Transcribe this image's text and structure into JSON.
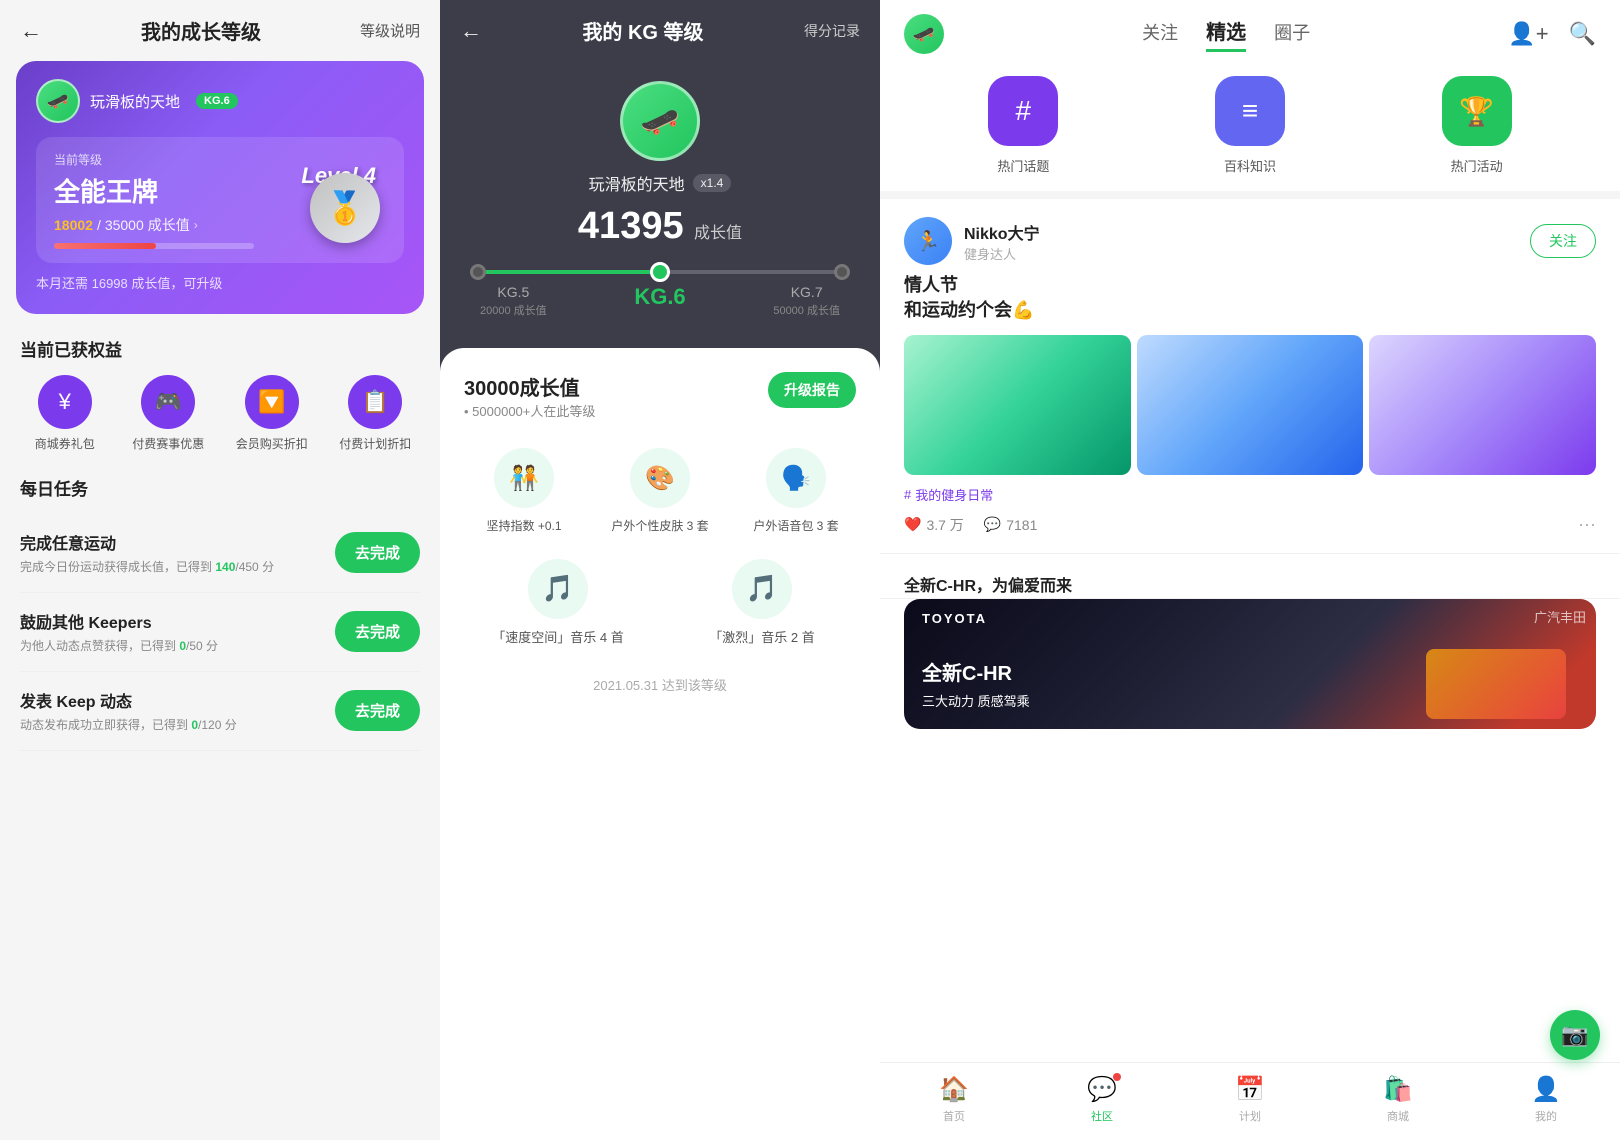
{
  "panel1": {
    "header": {
      "back_label": "←",
      "title": "我的成长等级",
      "desc_label": "等级说明"
    },
    "hero": {
      "username": "玩滑板的天地",
      "kg_badge": "KG.6",
      "current_level_label": "当前等级",
      "level_name": "全能王牌",
      "level_display": "Level 4",
      "progress_current": "18002",
      "progress_total": "35000",
      "progress_unit": "成长值",
      "upgrade_hint": "本月还需 16998 成长值，可升级",
      "medal_emoji": "🥇"
    },
    "benefits_title": "当前已获权益",
    "benefits": [
      {
        "icon": "¥",
        "label": "商城券礼包",
        "color": "#7c3aed"
      },
      {
        "icon": "🎮",
        "label": "付费赛事优惠",
        "color": "#7c3aed"
      },
      {
        "icon": "🔽",
        "label": "会员购买折扣",
        "color": "#7c3aed"
      },
      {
        "icon": "📋",
        "label": "付费计划折扣",
        "color": "#7c3aed"
      }
    ],
    "daily_tasks_title": "每日任务",
    "tasks": [
      {
        "name": "完成任意运动",
        "desc": "完成今日份运动获得成长值，已得到 140/450 分",
        "highlight_start": "140",
        "highlight_end": "450",
        "btn_label": "去完成"
      },
      {
        "name": "鼓励其他 Keepers",
        "desc": "为他人动态点赞获得，已得到 0/50 分",
        "highlight_start": "0",
        "highlight_end": "50",
        "btn_label": "去完成"
      },
      {
        "name": "发表 Keep 动态",
        "desc": "动态发布成功立即获得，已得到 0/120 分",
        "highlight_start": "0",
        "highlight_end": "120",
        "btn_label": "去完成"
      }
    ]
  },
  "panel2": {
    "header": {
      "back_label": "←",
      "title": "我的 KG 等级",
      "score_record": "得分记录"
    },
    "hero": {
      "username": "玩滑板的天地",
      "multiplier": "x1.4",
      "growth_value": "41395",
      "growth_unit": "成长值"
    },
    "slider": {
      "levels": [
        {
          "name": "KG.5",
          "sub": "20000 成长值",
          "active": false
        },
        {
          "name": "KG.6",
          "sub": "",
          "active": true
        },
        {
          "name": "KG.7",
          "sub": "50000 成长值",
          "active": false
        }
      ]
    },
    "card": {
      "growth_label": "30000成长值",
      "growth_unit": "",
      "population_text": "• 5000000+人在此等级",
      "upgrade_btn": "升级报告",
      "benefits": [
        {
          "icon": "🧑‍🤝‍🧑",
          "label": "坚持指数 +0.1"
        },
        {
          "icon": "🎨",
          "label": "户外个性皮肤 3 套"
        },
        {
          "icon": "🗣️",
          "label": "户外语音包 3 套"
        }
      ],
      "music": [
        {
          "icon": "🎵",
          "label": "「速度空间」音乐 4\n首"
        },
        {
          "icon": "🎵",
          "label": "「激烈」音乐 2 首"
        }
      ],
      "date_label": "2021.05.31 达到该等级"
    }
  },
  "panel3": {
    "header": {
      "nav_items": [
        {
          "label": "关注",
          "active": false
        },
        {
          "label": "精选",
          "active": true
        },
        {
          "label": "圈子",
          "active": false
        }
      ]
    },
    "quick_icons": [
      {
        "label": "热门话题",
        "icon": "#",
        "color": "purple"
      },
      {
        "label": "百科知识",
        "icon": "≡",
        "color": "blue"
      },
      {
        "label": "热门活动",
        "icon": "🏆",
        "color": "green"
      }
    ],
    "feed_items": [
      {
        "username": "Nikko大宁",
        "subtitle": "健身达人",
        "follow_label": "关注",
        "title": "情人节\n和运动约个会💪",
        "images": 3,
        "tag": "我的健身日常",
        "likes": "3.7 万",
        "comments": "7181"
      }
    ],
    "ad_card": {
      "title": "全新C-HR，为偏爱而来",
      "brand": "TOYOTA",
      "car_text": "全新C-HR\n三大动力 质感驾乘"
    },
    "bottom_nav": [
      {
        "label": "首页",
        "icon": "🏠",
        "active": false
      },
      {
        "label": "社区",
        "icon": "💬",
        "active": true,
        "badge": true
      },
      {
        "label": "计划",
        "icon": "📅",
        "active": false
      },
      {
        "label": "商城",
        "icon": "🛍️",
        "active": false
      },
      {
        "label": "我的",
        "icon": "👤",
        "active": false
      }
    ]
  }
}
